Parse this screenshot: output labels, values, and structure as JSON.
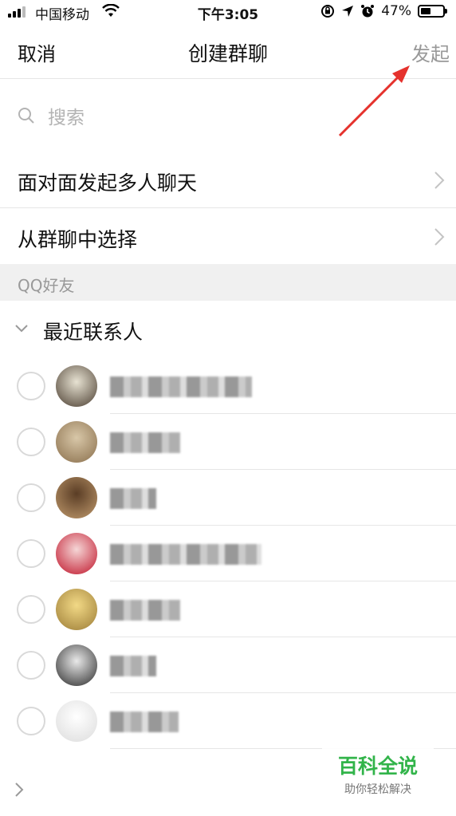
{
  "status_bar": {
    "carrier": "中国移动",
    "time": "下午3:05",
    "battery": "47%",
    "icons": [
      "signal-icon",
      "wifi-icon",
      "rotation-lock-icon",
      "location-icon",
      "alarm-icon",
      "battery-icon"
    ]
  },
  "nav": {
    "cancel_label": "取消",
    "title": "创建群聊",
    "start_label": "发起"
  },
  "search": {
    "placeholder": "搜索"
  },
  "options": [
    {
      "label": "面对面发起多人聊天"
    },
    {
      "label": "从群聊中选择"
    }
  ],
  "section_header": "QQ好友",
  "group": {
    "label": "最近联系人",
    "expanded": true
  },
  "contacts": [
    {
      "avatar_colors": [
        "#e7e2d2",
        "#4a3d30"
      ],
      "name_blurred": true
    },
    {
      "avatar_colors": [
        "#d8c7a8",
        "#8a6f4c"
      ],
      "name_blurred": true
    },
    {
      "avatar_colors": [
        "#5a3d25",
        "#c09a6d"
      ],
      "name_blurred": true
    },
    {
      "avatar_colors": [
        "#f5d6d6",
        "#c0142a"
      ],
      "name_blurred": true
    },
    {
      "avatar_colors": [
        "#f2d986",
        "#9c7c36"
      ],
      "name_blurred": true
    },
    {
      "avatar_colors": [
        "#e9e9e9",
        "#2a2a2a"
      ],
      "name_blurred": true
    },
    {
      "avatar_colors": [
        "#ffffff",
        "#dcdcdc"
      ],
      "name_blurred": true
    }
  ],
  "watermark": {
    "brand": "百科全说",
    "slogan": "助你轻松解决"
  },
  "colors": {
    "arrow": "#e5322d",
    "brand_green": "#32b44a",
    "divider": "#e6e6e6",
    "section_bg": "#f0f0f0"
  }
}
